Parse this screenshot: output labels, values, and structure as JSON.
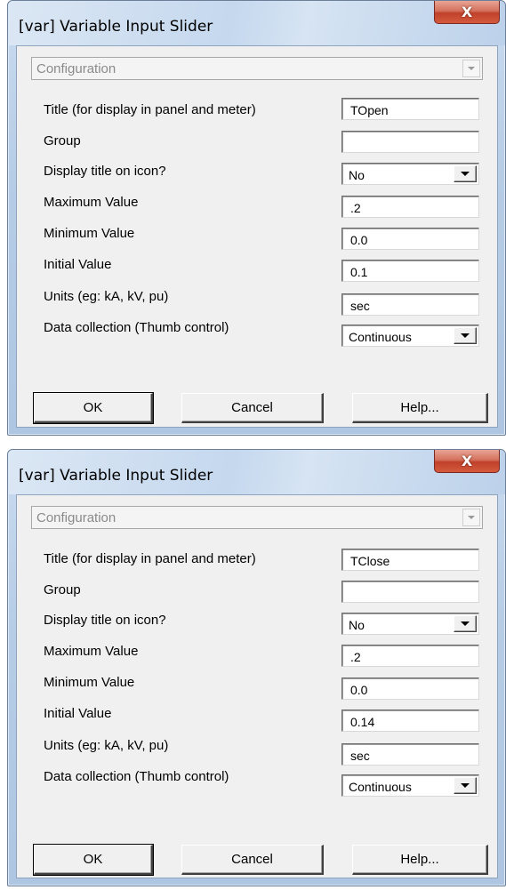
{
  "dialogs": [
    {
      "title": "[var] Variable Input Slider",
      "close_label": "X",
      "category": "Configuration",
      "fields": [
        {
          "label": "Title (for display in panel and meter)",
          "value": "TOpen",
          "type": "text"
        },
        {
          "label": "Group",
          "value": "",
          "type": "text"
        },
        {
          "label": "Display title on icon?",
          "value": "No",
          "type": "dropdown"
        },
        {
          "label": "Maximum Value",
          "value": ".2",
          "type": "text"
        },
        {
          "label": "Minimum Value",
          "value": "0.0",
          "type": "text"
        },
        {
          "label": "Initial Value",
          "value": "0.1",
          "type": "text"
        },
        {
          "label": "Units (eg: kA, kV, pu)",
          "value": "sec",
          "type": "text"
        },
        {
          "label": "Data collection (Thumb control)",
          "value": "Continuous",
          "type": "dropdown"
        }
      ],
      "buttons": {
        "ok": "OK",
        "cancel": "Cancel",
        "help": "Help..."
      }
    },
    {
      "title": "[var] Variable Input Slider",
      "close_label": "X",
      "category": "Configuration",
      "fields": [
        {
          "label": "Title (for display in panel and meter)",
          "value": "TClose",
          "type": "text"
        },
        {
          "label": "Group",
          "value": "",
          "type": "text"
        },
        {
          "label": "Display title on icon?",
          "value": "No",
          "type": "dropdown"
        },
        {
          "label": "Maximum Value",
          "value": ".2",
          "type": "text"
        },
        {
          "label": "Minimum Value",
          "value": "0.0",
          "type": "text"
        },
        {
          "label": "Initial Value",
          "value": "0.14",
          "type": "text"
        },
        {
          "label": "Units (eg: kA, kV, pu)",
          "value": "sec",
          "type": "text"
        },
        {
          "label": "Data collection (Thumb control)",
          "value": "Continuous",
          "type": "dropdown"
        }
      ],
      "buttons": {
        "ok": "OK",
        "cancel": "Cancel",
        "help": "Help..."
      }
    }
  ]
}
